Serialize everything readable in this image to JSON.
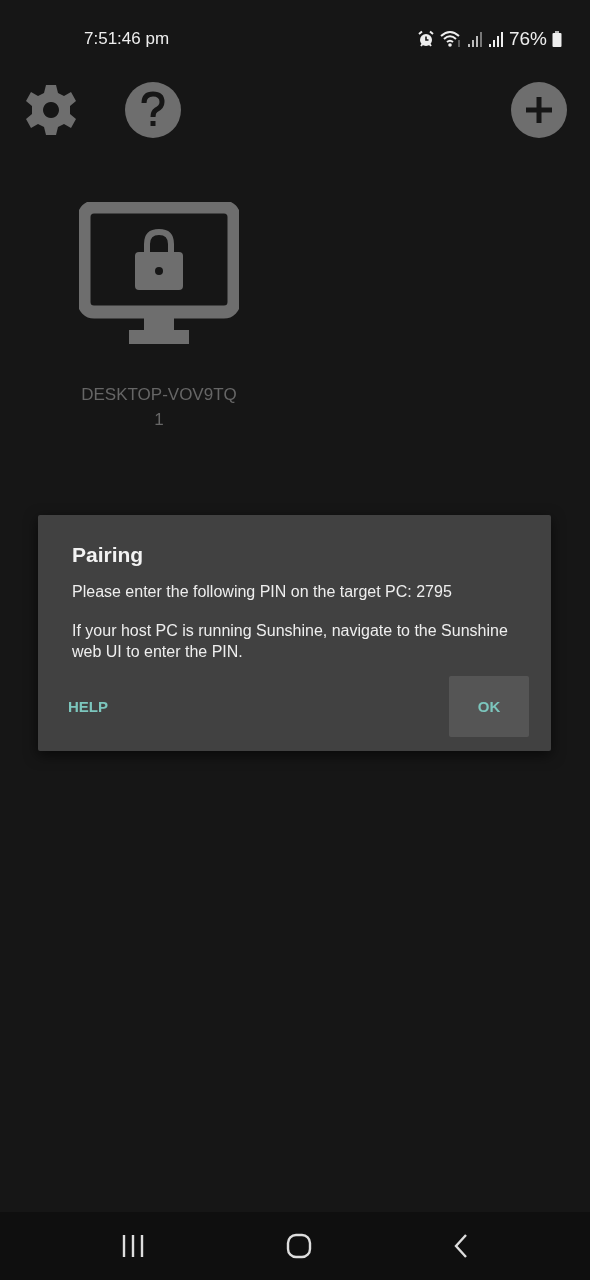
{
  "status_bar": {
    "time": "7:51:46 pm",
    "battery": "76%"
  },
  "toolbar": {
    "left_icons": [
      {
        "kind": "settings"
      },
      {
        "kind": "help"
      }
    ],
    "right_icons": [
      {
        "kind": "add"
      }
    ]
  },
  "computers": [
    {
      "name": "DESKTOP-VOV9TQ\n1",
      "locked": true
    }
  ],
  "dialog": {
    "title": "Pairing",
    "paragraphs": [
      "Please enter the following PIN on the target PC: 2795",
      "If your host PC is running Sunshine, navigate to the Sunshine web UI to enter the PIN."
    ],
    "buttons": [
      {
        "label": "HELP",
        "focused": false
      },
      {
        "label": "OK",
        "focused": true
      }
    ]
  },
  "nav_bar": [
    {
      "kind": "recents"
    },
    {
      "kind": "home"
    },
    {
      "kind": "back"
    }
  ]
}
